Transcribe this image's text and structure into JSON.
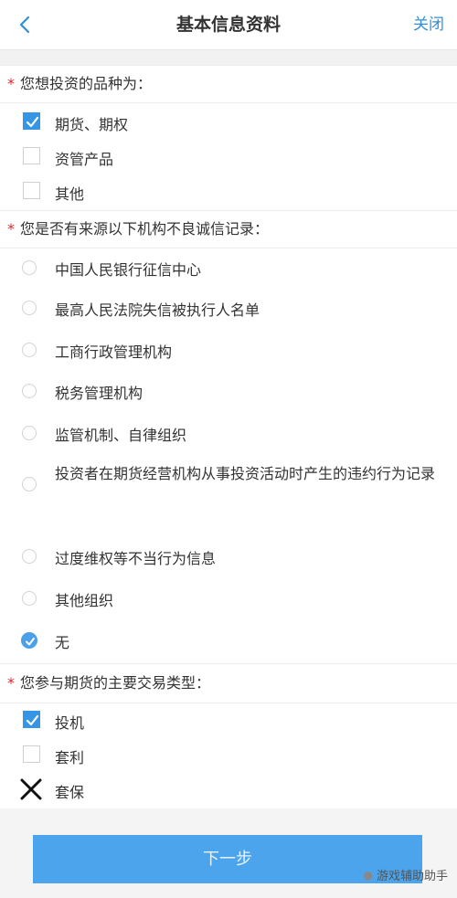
{
  "header": {
    "title": "基本信息资料",
    "close_label": "关闭"
  },
  "sections": {
    "invest_type": {
      "question": "您想投资的品种为：",
      "options": [
        {
          "label": "期货、期权",
          "checked": true
        },
        {
          "label": "资管产品",
          "checked": false
        },
        {
          "label": "其他",
          "checked": false
        }
      ]
    },
    "credit": {
      "question": "您是否有来源以下机构不良诚信记录：",
      "options": [
        {
          "label": "中国人民银行征信中心",
          "selected": false
        },
        {
          "label": "最高人民法院失信被执行人名单",
          "selected": false
        },
        {
          "label": "工商行政管理机构",
          "selected": false
        },
        {
          "label": "税务管理机构",
          "selected": false
        },
        {
          "label": "监管机制、自律组织",
          "selected": false
        },
        {
          "label": "投资者在期货经营机构从事投资活动时产生的违约行为记录",
          "selected": false
        },
        {
          "label": "过度维权等不当行为信息",
          "selected": false
        },
        {
          "label": "其他组织",
          "selected": false
        },
        {
          "label": "无",
          "selected": true
        }
      ]
    },
    "trade_type": {
      "question": "您参与期货的主要交易类型：",
      "options": [
        {
          "label": "投机",
          "checked": true
        },
        {
          "label": "套利",
          "checked": false
        },
        {
          "label": "套保",
          "checked": false,
          "marked": "x"
        }
      ]
    }
  },
  "footer": {
    "next_label": "下一步"
  },
  "watermark": {
    "text": "游戏辅助助手"
  },
  "colors": {
    "accent": "#3596e6",
    "required": "#e2262c",
    "button": "#4ba4ec"
  }
}
